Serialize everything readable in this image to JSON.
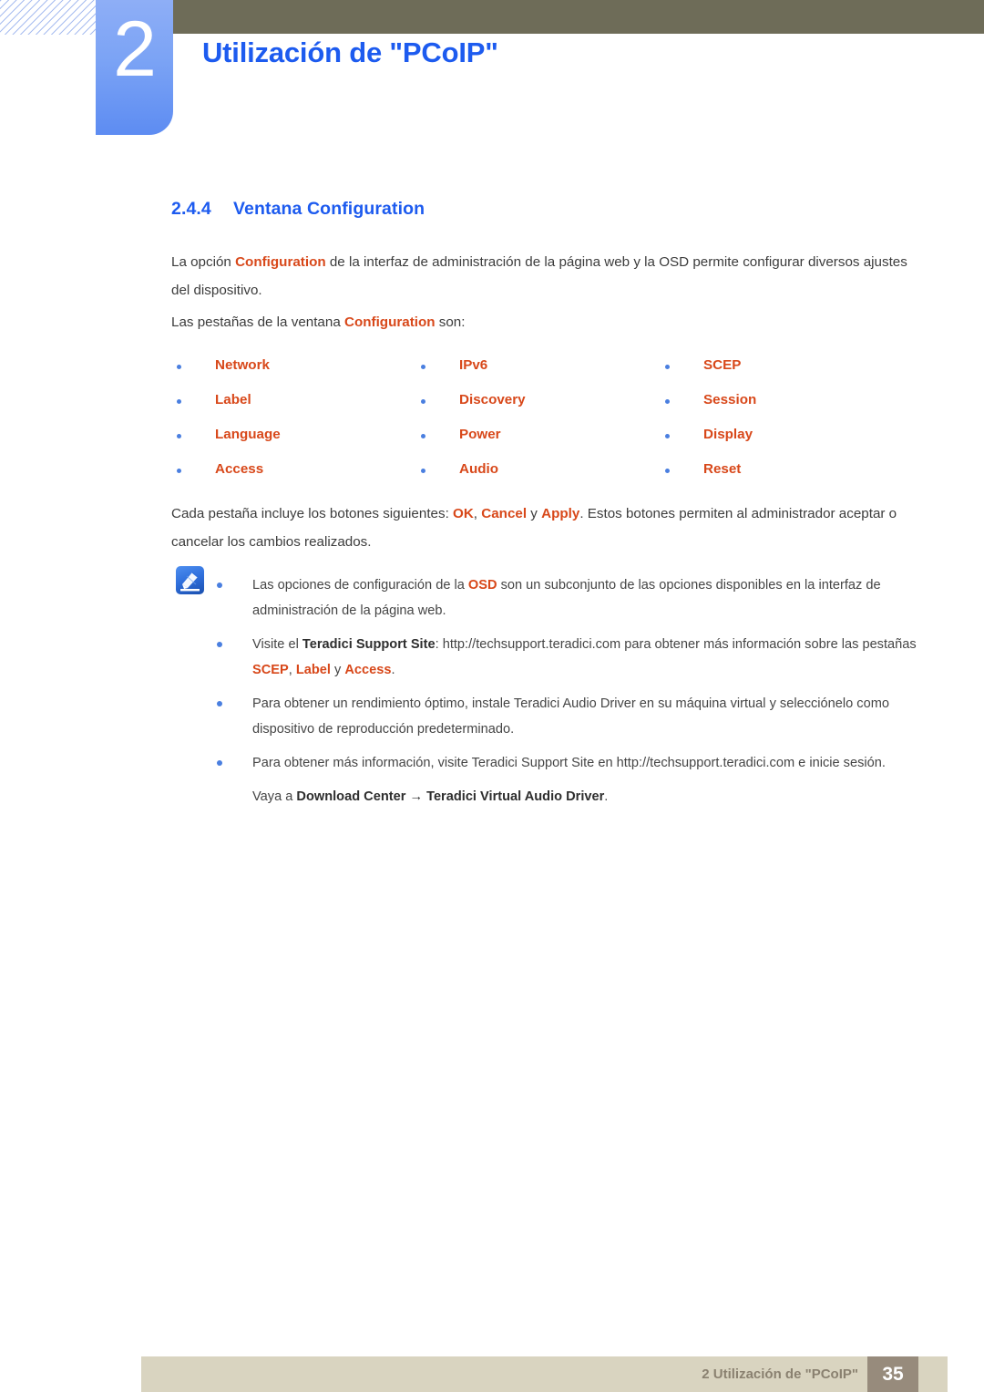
{
  "header": {
    "chapter_number": "2",
    "chapter_title": "Utilización de \"PCoIP\"",
    "bar_color": "#6e6c58",
    "tab_color": "#7ba3f5",
    "title_color": "#1d5bef"
  },
  "section": {
    "number": "2.4.4",
    "title": "Ventana Configuration"
  },
  "paragraphs": {
    "intro_a": "La opción ",
    "intro_highlight": "Configuration",
    "intro_b": " de la interfaz de administración de la página web y la OSD permite configurar diversos ajustes del dispositivo.",
    "tabs_lead_a": "Las pestañas de la ventana ",
    "tabs_lead_highlight": "Configuration",
    "tabs_lead_b": " son:",
    "buttons_a": "Cada pestaña incluye los botones siguientes: ",
    "buttons_ok": "OK",
    "buttons_sep1": ", ",
    "buttons_cancel": "Cancel",
    "buttons_sep2": " y ",
    "buttons_apply": "Apply",
    "buttons_b": ". Estos botones permiten al administrador aceptar o cancelar los cambios realizados."
  },
  "tab_list": {
    "rows": [
      [
        "Network",
        "IPv6",
        "SCEP"
      ],
      [
        "Label",
        "Discovery",
        "Session"
      ],
      [
        "Language",
        "Power",
        "Display"
      ],
      [
        "Access",
        "Audio",
        "Reset"
      ]
    ],
    "text_color": "#d8481a",
    "bullet_color": "#4a7fe0"
  },
  "note": {
    "icon": "note-pencil-icon",
    "items": [
      {
        "a": "Las opciones de configuración de la ",
        "hl1": "OSD",
        "b": " son un subconjunto de las opciones disponibles en la interfaz de administración de la página web."
      },
      {
        "a": "Visite el ",
        "bold1": "Teradici Support Site",
        "b": ": http://techsupport.teradici.com para obtener más información sobre las pestañas ",
        "hl1": "SCEP",
        "c": ", ",
        "hl2": "Label",
        "d": " y ",
        "hl3": "Access",
        "e": "."
      },
      {
        "a": "Para obtener un rendimiento óptimo, instale Teradici Audio Driver en su máquina virtual y selecciónelo como dispositivo de reproducción predeterminado."
      },
      {
        "a": "Para obtener más información, visite Teradici Support Site en http://techsupport.teradici.com e inicie sesión."
      }
    ],
    "trailing_a": "Vaya a ",
    "trailing_bold": "Download Center → Teradici Virtual Audio Driver",
    "trailing_b": "."
  },
  "footer": {
    "text": "2 Utilización de \"PCoIP\"",
    "page_number": "35",
    "bar_color": "#d9d4c0",
    "page_box_color": "#978b7c"
  }
}
